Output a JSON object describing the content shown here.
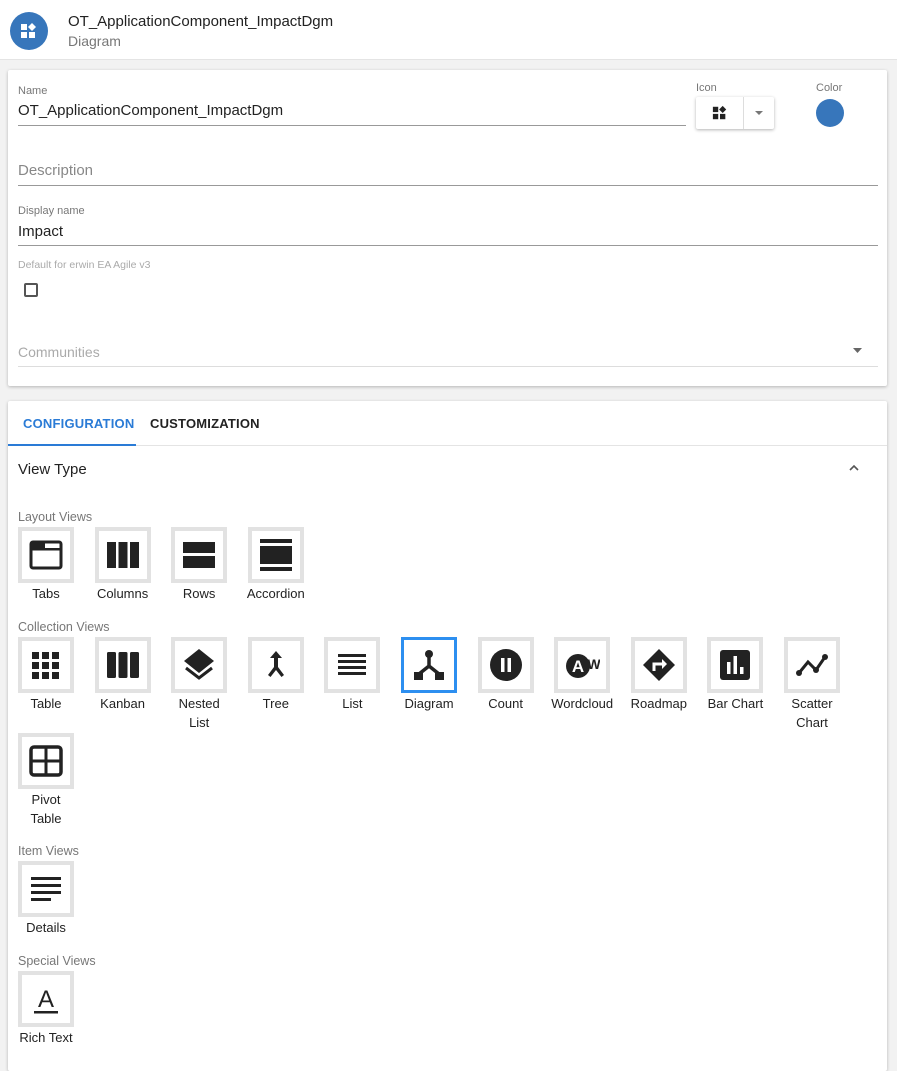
{
  "header": {
    "title": "OT_ApplicationComponent_ImpactDgm",
    "subtitle": "Diagram",
    "avatar_icon": "widgets-icon",
    "color": "#3776bb"
  },
  "form": {
    "name_label": "Name",
    "name_value": "OT_ApplicationComponent_ImpactDgm",
    "icon_label": "Icon",
    "icon_value": "widgets-icon",
    "color_label": "Color",
    "color_value": "#3776bb",
    "description_placeholder": "Description",
    "display_name_label": "Display name",
    "display_name_value": "Impact",
    "default_label": "Default for erwin EA Agile v3",
    "default_checked": false,
    "communities_placeholder": "Communities"
  },
  "tabs": [
    {
      "label": "CONFIGURATION",
      "active": true
    },
    {
      "label": "CUSTOMIZATION",
      "active": false
    }
  ],
  "view_type": {
    "title": "View Type",
    "groups": [
      {
        "label": "Layout Views",
        "items": [
          {
            "label": "Tabs",
            "icon": "tabs"
          },
          {
            "label": "Columns",
            "icon": "columns"
          },
          {
            "label": "Rows",
            "icon": "rows"
          },
          {
            "label": "Accordion",
            "icon": "accordion"
          }
        ]
      },
      {
        "label": "Collection Views",
        "items": [
          {
            "label": "Table",
            "icon": "table"
          },
          {
            "label": "Kanban",
            "icon": "kanban"
          },
          {
            "label": "Nested List",
            "icon": "layers"
          },
          {
            "label": "Tree",
            "icon": "tree"
          },
          {
            "label": "List",
            "icon": "list"
          },
          {
            "label": "Diagram",
            "icon": "diagram",
            "selected": true
          },
          {
            "label": "Count",
            "icon": "count"
          },
          {
            "label": "Wordcloud",
            "icon": "wordcloud"
          },
          {
            "label": "Roadmap",
            "icon": "roadmap"
          },
          {
            "label": "Bar Chart",
            "icon": "barchart"
          },
          {
            "label": "Scatter Chart",
            "icon": "scatter"
          },
          {
            "label": "Pivot Table",
            "icon": "pivot"
          }
        ]
      },
      {
        "label": "Item Views",
        "items": [
          {
            "label": "Details",
            "icon": "details"
          }
        ]
      },
      {
        "label": "Special Views",
        "items": [
          {
            "label": "Rich Text",
            "icon": "richtext"
          }
        ]
      }
    ]
  }
}
